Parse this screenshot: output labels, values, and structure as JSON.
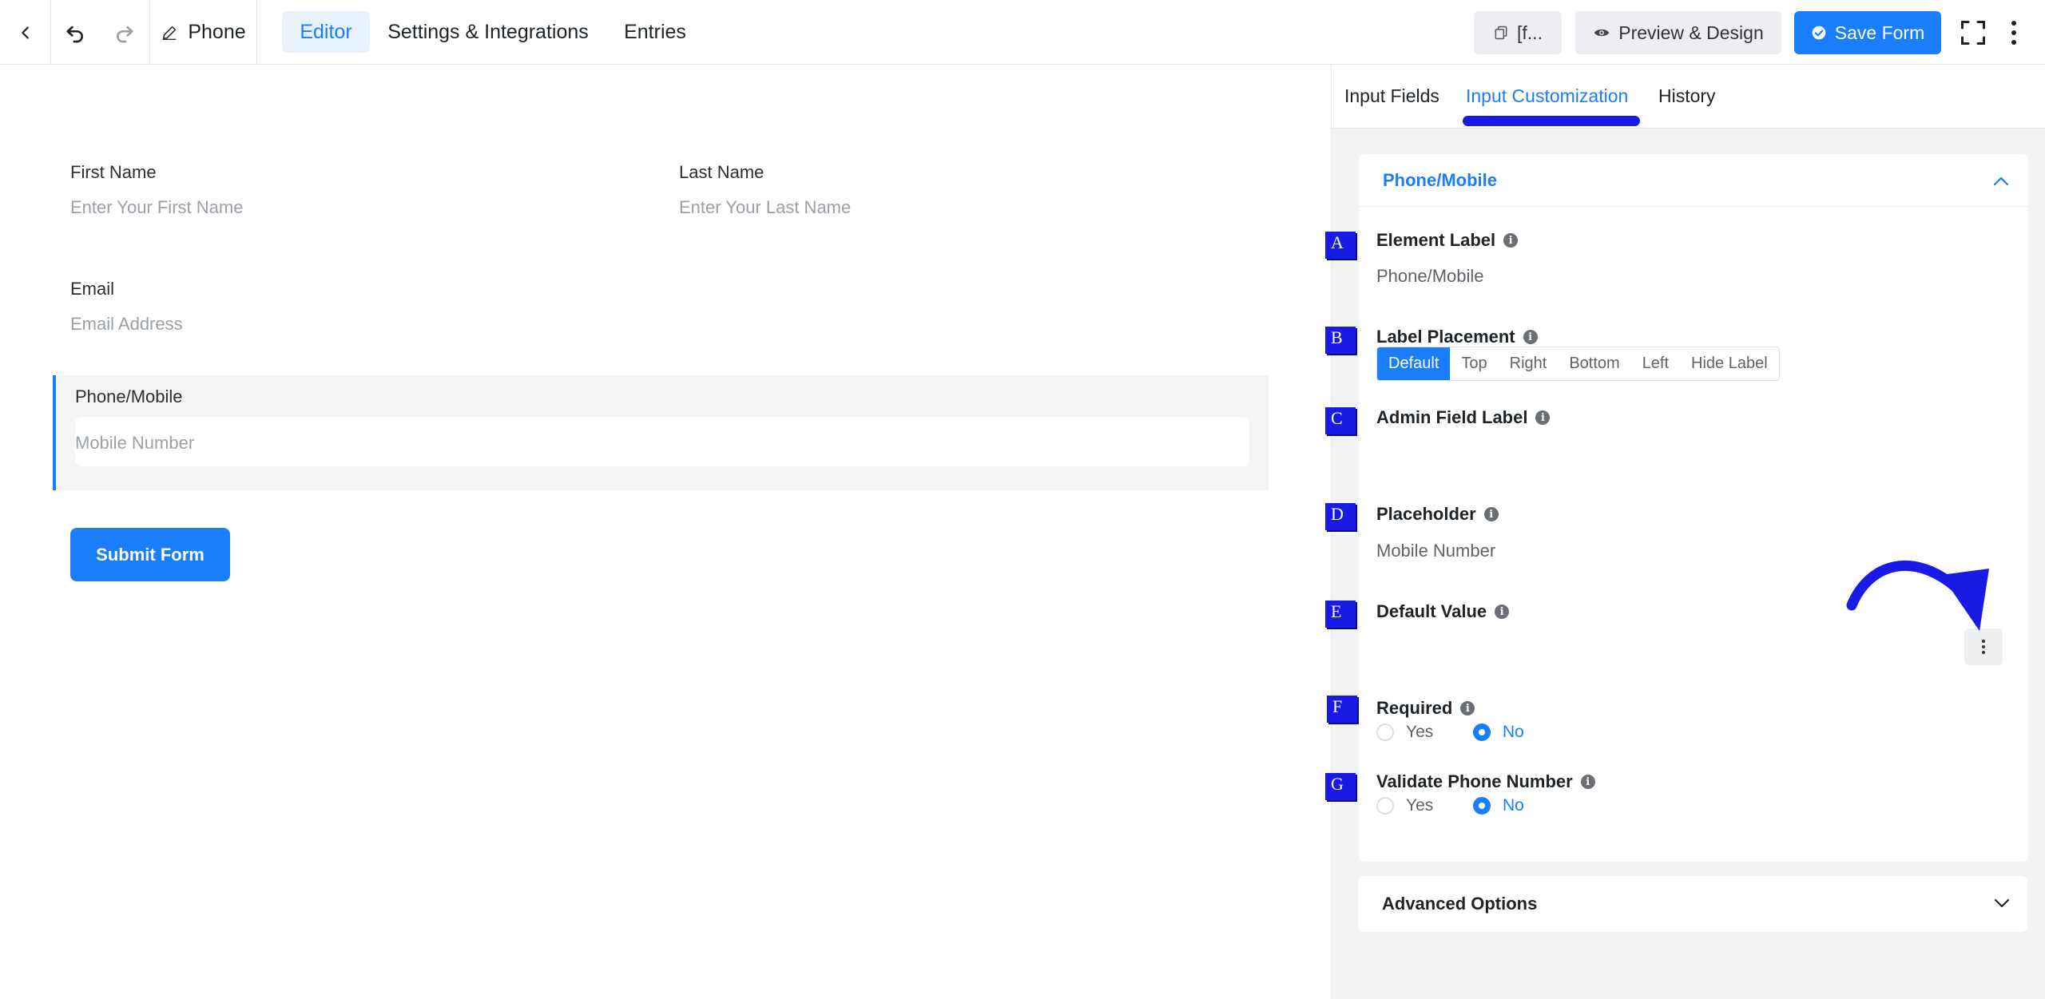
{
  "topbar": {
    "form_name": "Phone",
    "nav_tabs": [
      "Editor",
      "Settings & Integrations",
      "Entries"
    ],
    "shortcode_label": "[f...",
    "preview_label": "Preview & Design",
    "save_label": "Save Form"
  },
  "form": {
    "first_name_label": "First Name",
    "first_name_placeholder": "Enter Your First Name",
    "last_name_label": "Last Name",
    "last_name_placeholder": "Enter Your Last Name",
    "email_label": "Email",
    "email_placeholder": "Email Address",
    "phone_label": "Phone/Mobile",
    "phone_placeholder": "Mobile Number",
    "submit_label": "Submit Form"
  },
  "panel": {
    "tabs": [
      "Input Fields",
      "Input Customization",
      "History"
    ],
    "active_tab": "Input Customization",
    "card_title": "Phone/Mobile",
    "element_label_title": "Element Label",
    "element_label_value": "Phone/Mobile",
    "label_placement_title": "Label Placement",
    "label_placement_options": [
      "Default",
      "Top",
      "Right",
      "Bottom",
      "Left",
      "Hide Label"
    ],
    "label_placement_selected": "Default",
    "admin_field_label_title": "Admin Field Label",
    "placeholder_title": "Placeholder",
    "placeholder_value": "Mobile Number",
    "default_value_title": "Default Value",
    "required_title": "Required",
    "validate_title": "Validate Phone Number",
    "yes_label": "Yes",
    "no_label": "No",
    "required_selected": "No",
    "validate_selected": "No",
    "advanced_title": "Advanced Options"
  },
  "markers": [
    "A",
    "B",
    "C",
    "D",
    "E",
    "F",
    "G"
  ],
  "colors": {
    "accent": "#1a7efb",
    "annotation": "#1a1ae6"
  }
}
